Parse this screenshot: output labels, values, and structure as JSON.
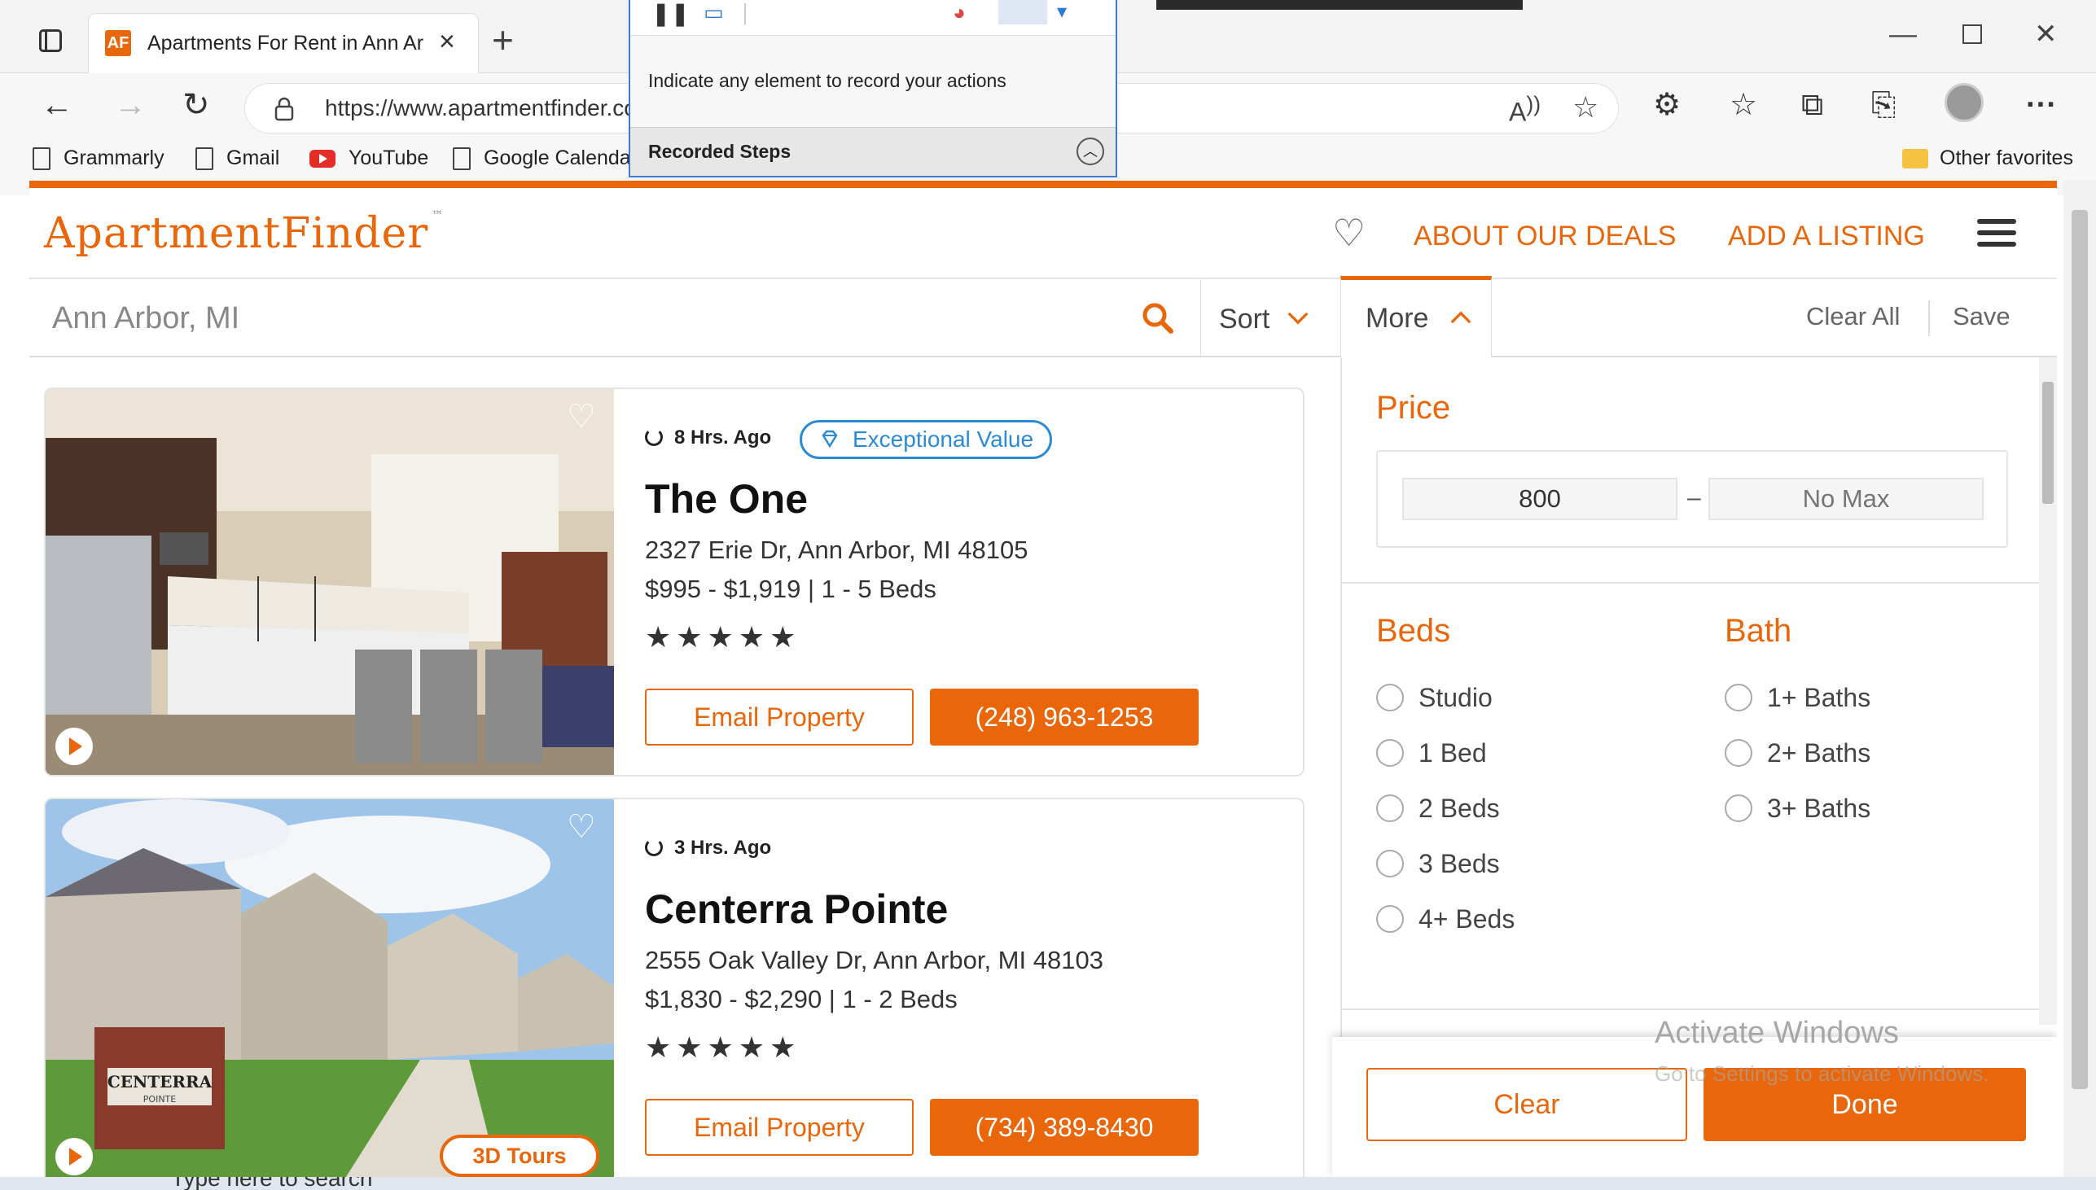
{
  "browser": {
    "tab_title": "Apartments For Rent in Ann Arbor",
    "favicon_text": "AF",
    "url": "https://www.apartmentfinder.com",
    "bookmarks": [
      {
        "label": "Grammarly"
      },
      {
        "label": "Gmail"
      },
      {
        "label": "YouTube"
      },
      {
        "label": "Google Calendar"
      }
    ],
    "other_favorites": "Other favorites"
  },
  "steps_recorder": {
    "instruction": "Indicate any element to record your actions",
    "recorded_steps_label": "Recorded Steps"
  },
  "site": {
    "logo": "ApartmentFinder",
    "logo_tm": "™",
    "nav": {
      "deals": "ABOUT OUR DEALS",
      "add_listing": "ADD A LISTING"
    },
    "brand_color": "#e9660b"
  },
  "search": {
    "location_value": "Ann Arbor, MI",
    "sort_label": "Sort",
    "more_label": "More",
    "clear_all": "Clear All",
    "save": "Save"
  },
  "listings": [
    {
      "updated": "8 Hrs. Ago",
      "badge": "Exceptional Value",
      "name": "The One",
      "address": "2327 Erie Dr, Ann Arbor, MI 48105",
      "price_beds": "$995 - $1,919 | 1 - 5 Beds",
      "stars": "★★★★★",
      "rating": 5,
      "email_label": "Email Property",
      "phone": "(248) 963-1253"
    },
    {
      "updated": "3 Hrs. Ago",
      "name": "Centerra Pointe",
      "address": "2555 Oak Valley Dr, Ann Arbor, MI 48103",
      "price_beds": "$1,830 - $2,290 | 1 - 2 Beds",
      "stars": "★★★★★",
      "rating": 5,
      "email_label": "Email Property",
      "phone": "(734) 389-8430",
      "tours_label": "3D Tours",
      "sign_text": "CENTERRA",
      "sign_sub": "POINTE"
    }
  ],
  "filters": {
    "price_label": "Price",
    "price_min": "800",
    "price_max_placeholder": "No Max",
    "price_dash": "–",
    "beds_label": "Beds",
    "beds_options": [
      "Studio",
      "1 Bed",
      "2 Beds",
      "3 Beds",
      "4+ Beds"
    ],
    "bath_label": "Bath",
    "bath_options": [
      "1+ Baths",
      "2+ Baths",
      "3+ Baths"
    ],
    "clear_label": "Clear",
    "done_label": "Done"
  },
  "watermark": {
    "line1": "Activate Windows",
    "line2": "Go to Settings to activate Windows."
  },
  "taskbar": {
    "search_placeholder": "Type here to search"
  }
}
